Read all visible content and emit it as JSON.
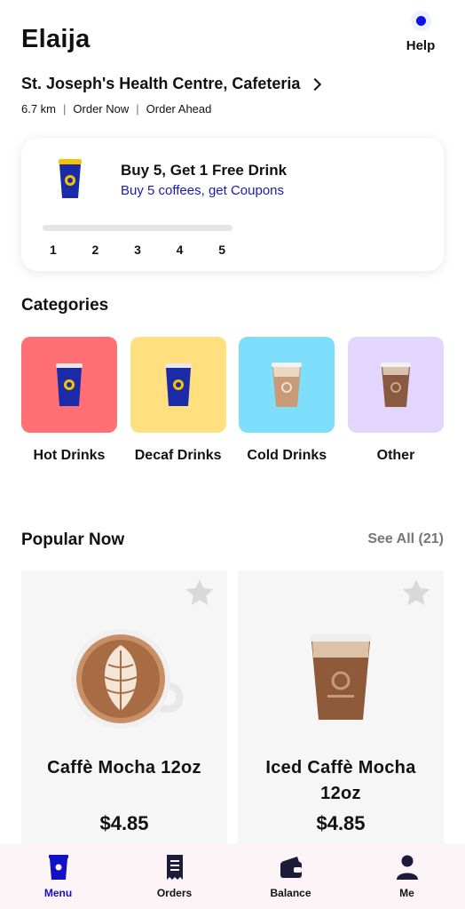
{
  "header": {
    "user_name": "Elaija",
    "help_label": "Help"
  },
  "location": {
    "name": "St. Joseph's Health Centre, Cafeteria",
    "distance": "6.7 km",
    "order_now": "Order Now",
    "order_ahead": "Order Ahead"
  },
  "reward": {
    "title": "Buy 5, Get 1 Free Drink",
    "subtitle": "Buy 5 coffees, get Coupons",
    "steps": [
      "1",
      "2",
      "3",
      "4",
      "5"
    ],
    "progress": 0
  },
  "categories": {
    "title": "Categories",
    "items": [
      {
        "label": "Hot Drinks",
        "color": "#ff6f73"
      },
      {
        "label": "Decaf Drinks",
        "color": "#ffdf7e"
      },
      {
        "label": "Cold Drinks",
        "color": "#7fdefc"
      },
      {
        "label": "Other",
        "color": "#e2d6ff"
      }
    ]
  },
  "popular": {
    "title": "Popular Now",
    "see_all": "See All (21)",
    "items": [
      {
        "name": "Caffè Mocha 12oz",
        "price": "$4.85"
      },
      {
        "name": "Iced Caffè Mocha 12oz",
        "price": "$4.85"
      }
    ]
  },
  "nav": {
    "menu": "Menu",
    "orders": "Orders",
    "balance": "Balance",
    "me": "Me"
  },
  "colors": {
    "accent": "#1010c8",
    "cup_blue": "#1a2aa8",
    "cup_yellow": "#f5c400"
  }
}
